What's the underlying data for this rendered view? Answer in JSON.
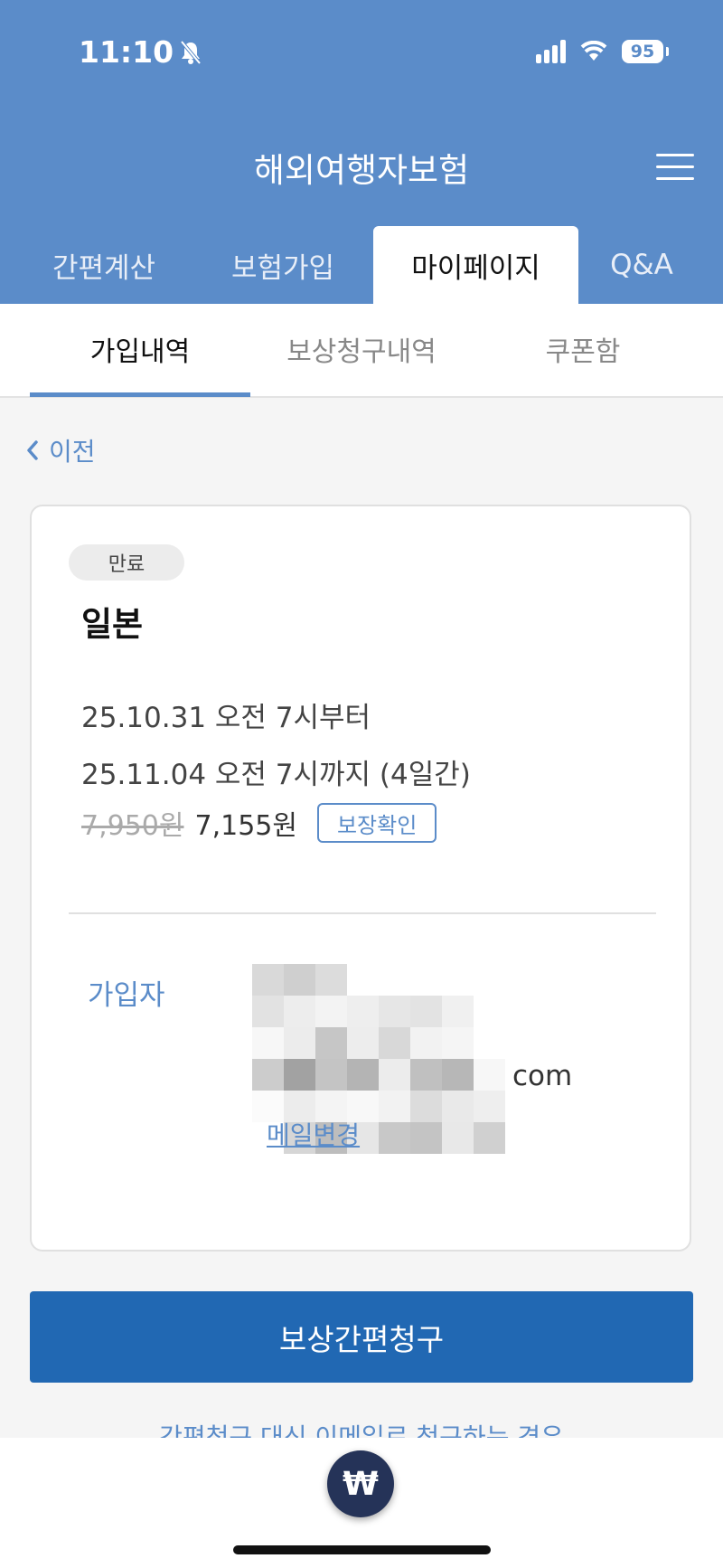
{
  "status_bar": {
    "time": "11:10",
    "battery": "95"
  },
  "header": {
    "title": "해외여행자보험",
    "tabs": [
      {
        "label": "간편계산"
      },
      {
        "label": "보험가입"
      },
      {
        "label": "마이페이지"
      },
      {
        "label": "Q&A"
      }
    ],
    "active_tab": "마이페이지"
  },
  "sub_tabs": {
    "items": [
      {
        "label": "가입내역"
      },
      {
        "label": "보상청구내역"
      },
      {
        "label": "쿠폰함"
      }
    ],
    "active": "가입내역"
  },
  "back": {
    "label": "이전"
  },
  "card": {
    "status_badge": "만료",
    "destination": "일본",
    "period_start": "25.10.31 오전 7시부터",
    "period_end": "25.11.04 오전 7시까지 (4일간)",
    "original_price": "7,950원",
    "final_price": "7,155원",
    "coverage_button": "보장확인",
    "subscriber_label": "가입자",
    "email_suffix": "com",
    "email_change_link": "메일변경"
  },
  "claim_button": "보상간편청구",
  "email_claim_text": "간편청구 대신 이메일로 청구하는 경우",
  "fab": {
    "symbol": "₩"
  },
  "colors": {
    "header_bg": "#5b8cc9",
    "primary_button": "#2168b3",
    "link": "#5b8cc9",
    "fab_bg": "#253358"
  }
}
